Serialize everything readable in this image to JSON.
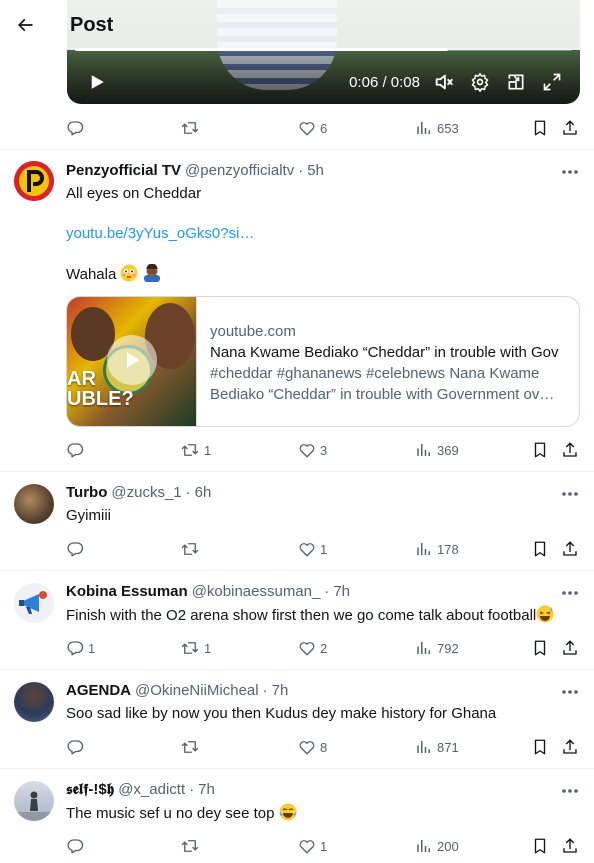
{
  "header": {
    "title": "Post"
  },
  "video": {
    "time_display": "0:06 / 0:08",
    "progress": 0.75
  },
  "main_tweet_actions": {
    "replies": "",
    "retweets": "",
    "likes": "6",
    "views": "653"
  },
  "replies": [
    {
      "name": "Penzyofficial TV",
      "handle": "@penzyofficialtv",
      "time": "5h",
      "text_line1": "All eyes on Cheddar",
      "link": "youtu.be/3yYus_oGks0?si…",
      "text_line3": "Wahala",
      "card": {
        "thumb_text": "AR\nUBLE?",
        "domain": "youtube.com",
        "title": "Nana Kwame Bediako “Cheddar” in trouble with Gov",
        "desc_line1": "#cheddar #ghananews #celebnews Nana Kwame",
        "desc_line2": "Bediako “Cheddar” in trouble with Government ov…"
      },
      "actions": {
        "replies": "",
        "retweets": "1",
        "likes": "3",
        "views": "369"
      }
    },
    {
      "name": "Turbo",
      "handle": "@zucks_1",
      "time": "6h",
      "text": "Gyimiii",
      "actions": {
        "replies": "",
        "retweets": "",
        "likes": "1",
        "views": "178"
      }
    },
    {
      "name": "Kobina Essuman",
      "handle": "@kobinaessuman_",
      "time": "7h",
      "text": "Finish with the O2 arena show first then we go come talk about football",
      "actions": {
        "replies": "1",
        "retweets": "1",
        "likes": "2",
        "views": "792"
      }
    },
    {
      "name": "AGENDA",
      "handle": "@OkineNiiMicheal",
      "time": "7h",
      "text": "Soo sad like by now you then Kudus dey make history for Ghana",
      "actions": {
        "replies": "",
        "retweets": "",
        "likes": "8",
        "views": "871"
      }
    },
    {
      "name": "𝖘𝖊𝖑𝖋-!$𝖍",
      "handle": "@x_adictt",
      "time": "7h",
      "text": "The music sef u no dey see top",
      "actions": {
        "replies": "",
        "retweets": "",
        "likes": "1",
        "views": "200"
      }
    }
  ],
  "icons": {
    "back": "arrow-left-icon",
    "play": "play-icon",
    "mute": "volume-mute-icon",
    "settings": "gear-icon",
    "pip": "picture-in-picture-icon",
    "fullscreen": "fullscreen-icon",
    "reply": "reply-icon",
    "retweet": "retweet-icon",
    "like": "heart-icon",
    "views": "views-icon",
    "bookmark": "bookmark-icon",
    "share": "share-icon",
    "more": "more-icon"
  },
  "colors": {
    "text": "#0f1419",
    "muted": "#536471",
    "link": "#1d9bf0",
    "border": "#eff3f4"
  }
}
